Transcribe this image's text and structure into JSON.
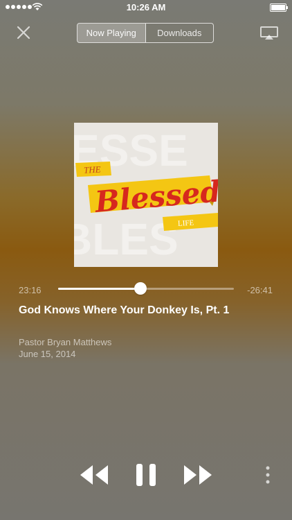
{
  "status": {
    "time": "10:26 AM",
    "battery_level": 1.0
  },
  "header": {
    "close_icon": "close-icon",
    "tabs": [
      {
        "label": "Now Playing",
        "active": true
      },
      {
        "label": "Downloads",
        "active": false
      }
    ],
    "airplay_icon": "airplay-icon"
  },
  "artwork": {
    "series_small_top": "THE",
    "series_main": "Blessed",
    "series_small_bottom": "LIFE"
  },
  "player": {
    "elapsed": "23:16",
    "remaining": "-26:41",
    "progress": 0.47
  },
  "episode": {
    "title": "God Knows Where Your Donkey Is, Pt. 1",
    "speaker": "Pastor Bryan Matthews",
    "date": "June 15, 2014"
  },
  "controls": {
    "rewind_icon": "rewind-icon",
    "pause_icon": "pause-icon",
    "fast_forward_icon": "fast-forward-icon",
    "more_icon": "more-vertical-icon"
  },
  "colors": {
    "accent_yellow": "#f4c613",
    "accent_red": "#d6281e",
    "artwork_bg": "#e9e6e1"
  }
}
